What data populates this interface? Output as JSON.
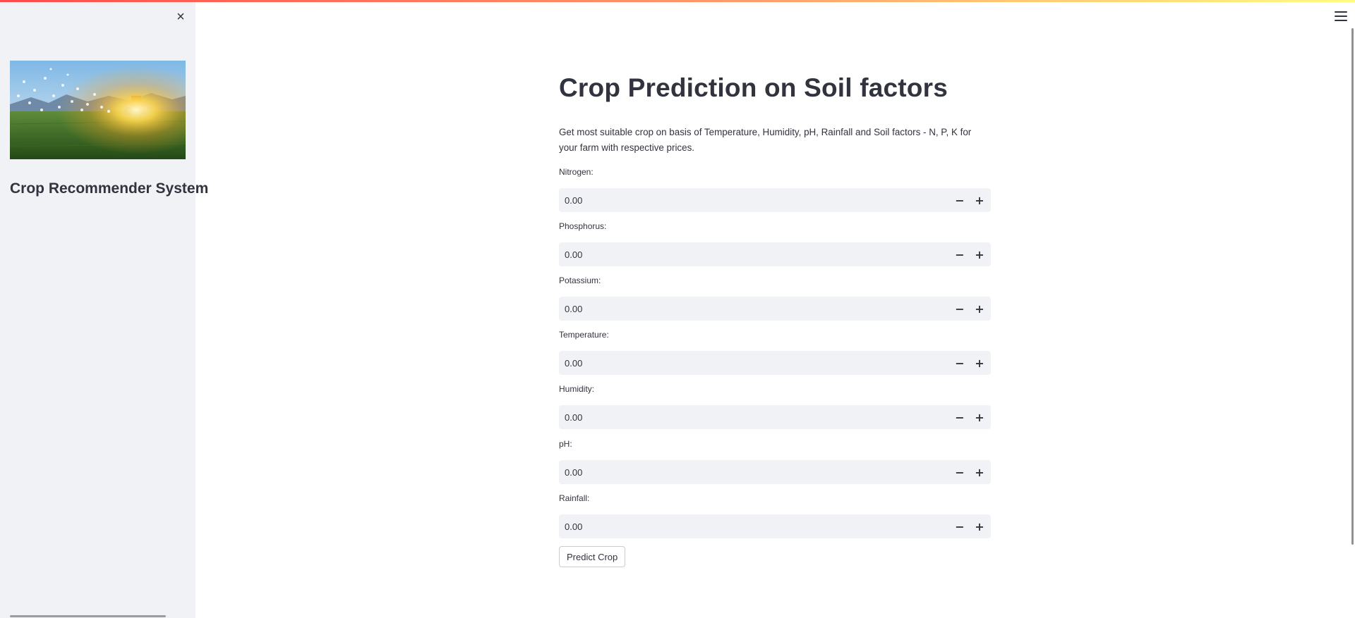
{
  "colors": {
    "accent_start": "#ff4b4b",
    "accent_end": "#fffd80",
    "sidebar_bg": "#f0f2f6",
    "input_bg": "#f0f2f6",
    "text": "#31333f"
  },
  "sidebar": {
    "close_icon": "×",
    "image_alt": "farm-field-sunrise-image",
    "title": "Crop Recommender System"
  },
  "header": {
    "menu_icon": "hamburger-menu-icon"
  },
  "main": {
    "title": "Crop Prediction on Soil factors",
    "description": "Get most suitable crop on basis of Temperature, Humidity, pH, Rainfall and Soil factors - N, P, K for your farm with respective prices.",
    "fields": [
      {
        "label": "Nitrogen:",
        "value": "0.00"
      },
      {
        "label": "Phosphorus:",
        "value": "0.00"
      },
      {
        "label": "Potassium:",
        "value": "0.00"
      },
      {
        "label": "Temperature:",
        "value": "0.00"
      },
      {
        "label": "Humidity:",
        "value": "0.00"
      },
      {
        "label": "pH:",
        "value": "0.00"
      },
      {
        "label": "Rainfall:",
        "value": "0.00"
      }
    ],
    "stepper_minus": "−",
    "stepper_plus": "+",
    "predict_button": "Predict Crop"
  }
}
